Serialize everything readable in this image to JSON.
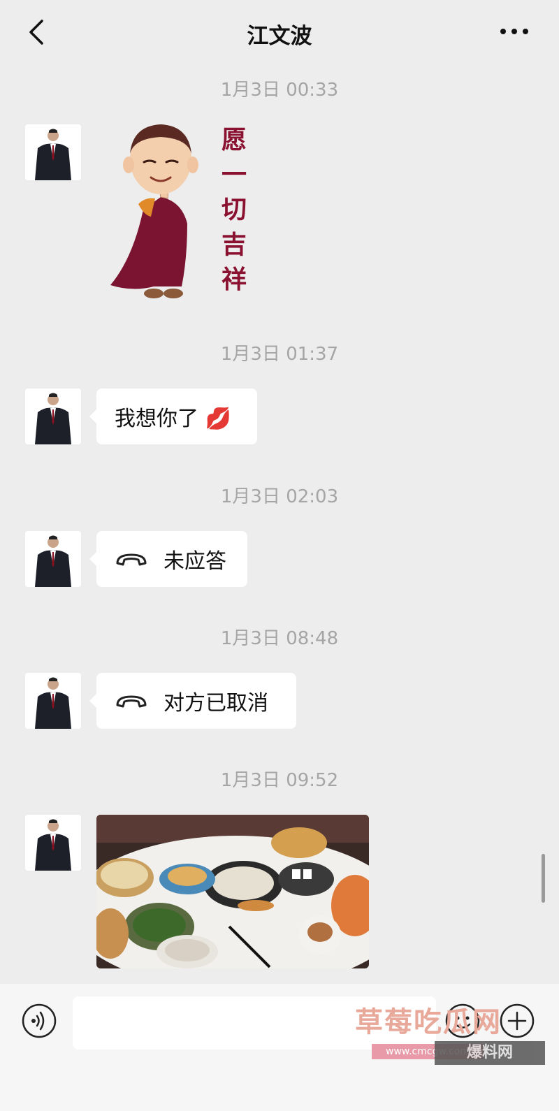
{
  "header": {
    "title": "江文波"
  },
  "messages": [
    {
      "timestamp": "1月3日 00:33",
      "type": "sticker",
      "sticker_text": "愿一切吉祥"
    },
    {
      "timestamp": "1月3日 01:37",
      "type": "text",
      "text": "我想你了 💋"
    },
    {
      "timestamp": "1月3日 02:03",
      "type": "call",
      "text": "未应答"
    },
    {
      "timestamp": "1月3日 08:48",
      "type": "call",
      "text": "对方已取消"
    },
    {
      "timestamp": "1月3日 09:52",
      "type": "image"
    }
  ],
  "watermark": {
    "main": "草莓吃瓜网",
    "url": "www.cmcgw.com",
    "badge": "爆料网"
  },
  "colors": {
    "background": "#ededed",
    "bubble": "#ffffff",
    "timestamp": "#a5a5a5",
    "robe": "#7a1430",
    "sticker_text": "#8a1230"
  },
  "icons": [
    "back-chevron-icon",
    "more-dots-icon",
    "phone-hangup-icon",
    "voice-icon",
    "emoji-icon",
    "plus-icon"
  ]
}
